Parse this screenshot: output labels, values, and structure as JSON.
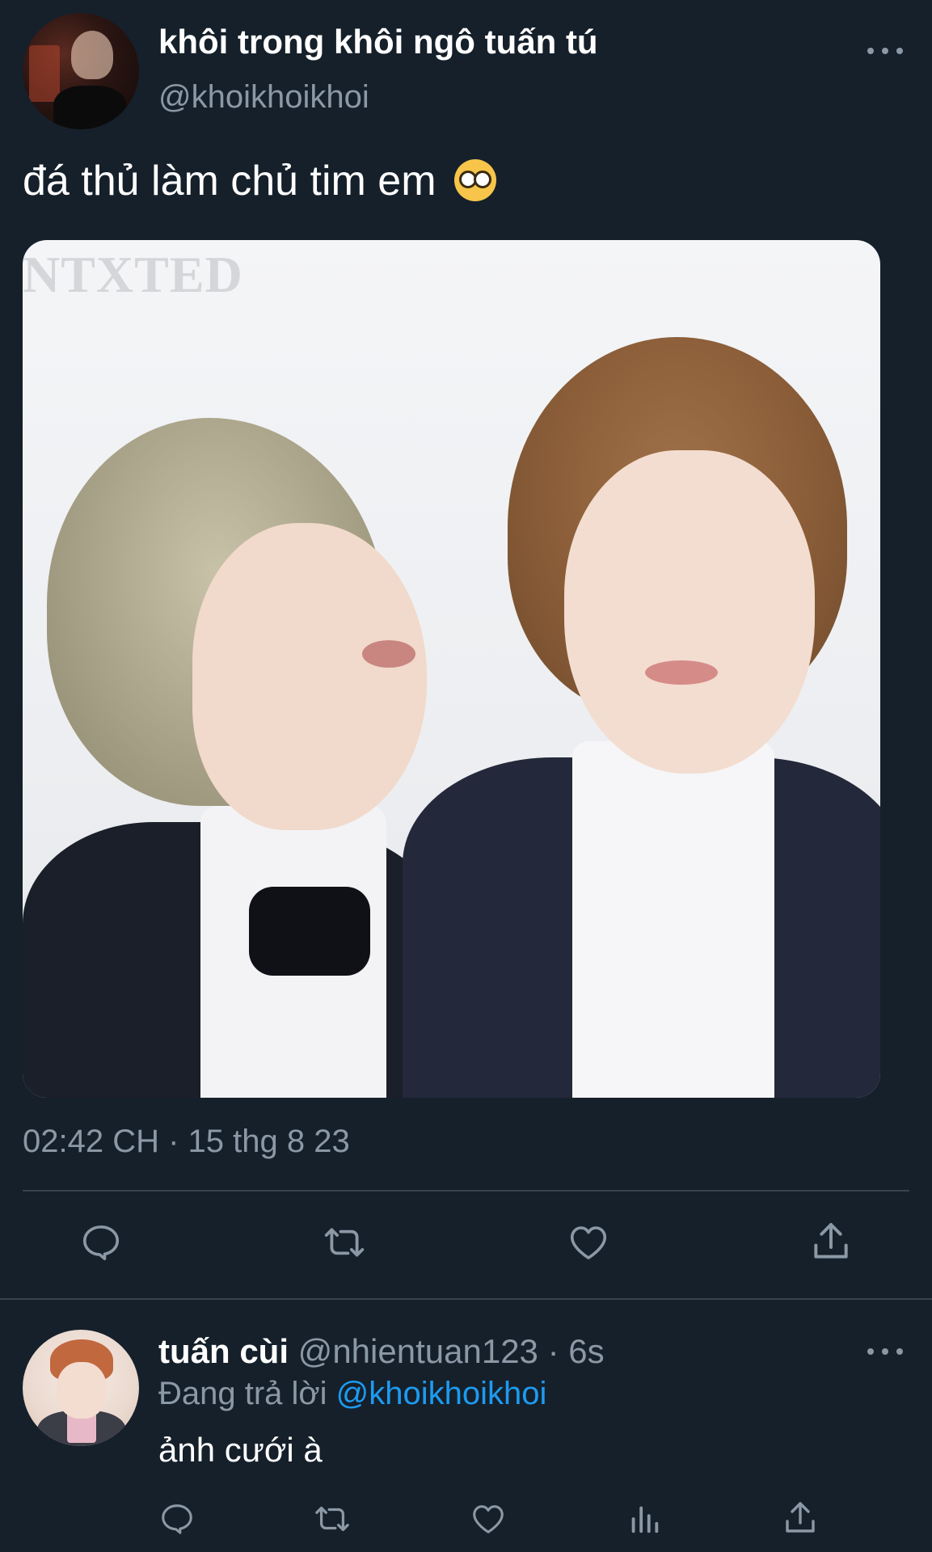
{
  "tweet": {
    "display_name": "khôi trong khôi ngô tuấn tú",
    "handle": "@khoikhoikhoi",
    "text": "đá thủ làm chủ tim em",
    "emoji": "nerd-face-emoji",
    "media": {
      "watermark_text": "NTXTED"
    },
    "timestamp": "02:42 CH · 15 thg 8 23",
    "actions": [
      "reply-icon",
      "retweet-icon",
      "like-icon",
      "share-icon"
    ]
  },
  "reply": {
    "display_name": "tuấn cùi",
    "meta": " @nhientuan123 · 6s",
    "replying_prefix": "Đang trả lời ",
    "replying_mention": "@khoikhoikhoi",
    "text": "ảnh cưới à",
    "actions": [
      "reply-icon",
      "retweet-icon",
      "like-icon",
      "views-icon",
      "share-icon"
    ]
  },
  "colors": {
    "background": "#15202b",
    "secondary_text": "#8b98a5",
    "link": "#1d9bf0",
    "divider": "#38444d"
  }
}
